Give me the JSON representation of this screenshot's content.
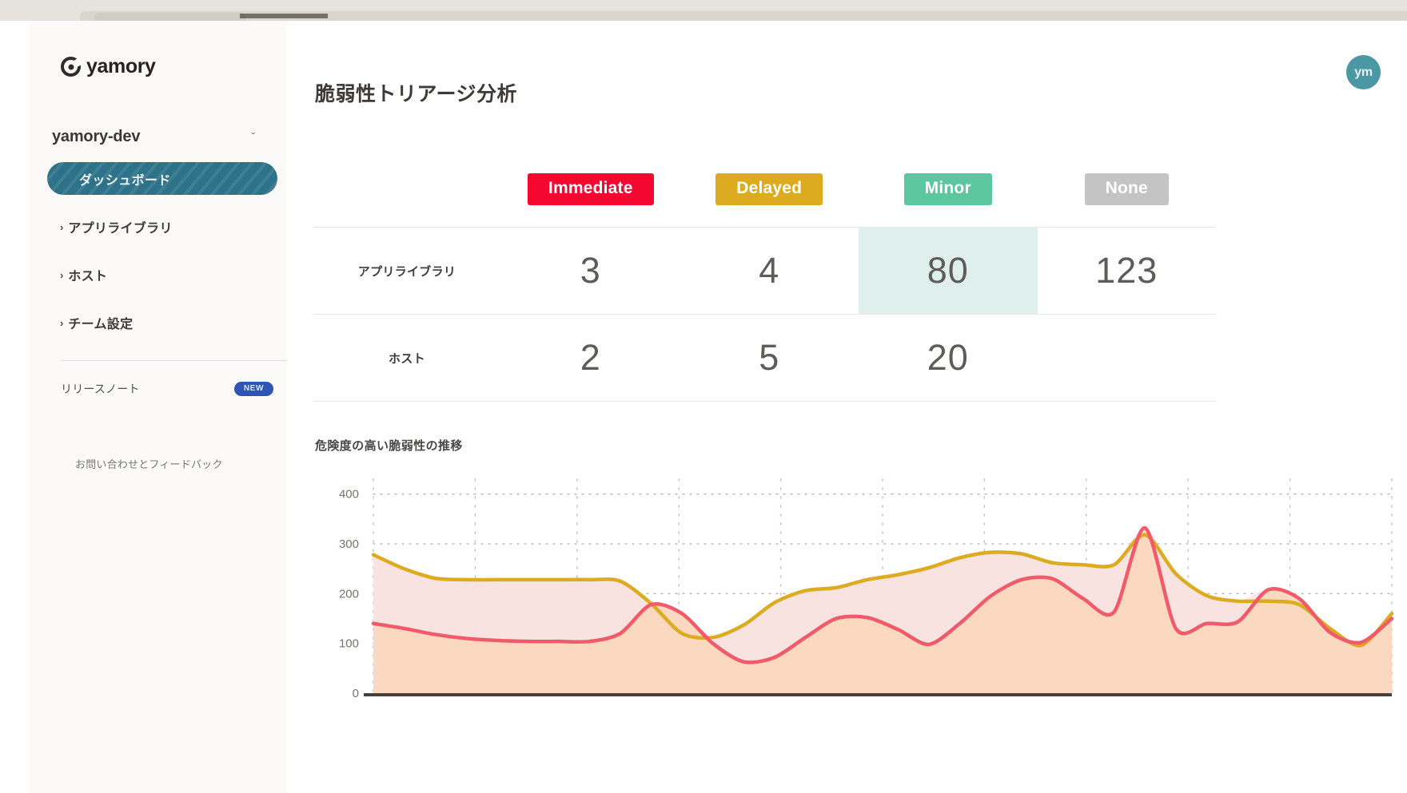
{
  "browser": {
    "tab_title": ""
  },
  "sidebar": {
    "brand": {
      "name": "yamory",
      "icon": "yamory-logo-icon"
    },
    "org": {
      "name": "yamory-dev",
      "caret": "ˇ"
    },
    "items": [
      {
        "label": "ダッシュボード",
        "active": true
      },
      {
        "label": "アプリライブラリ",
        "active": false,
        "chevron": "›"
      },
      {
        "label": "ホスト",
        "active": false,
        "chevron": "›"
      },
      {
        "label": "チーム設定",
        "active": false,
        "chevron": "›"
      }
    ],
    "release_notes": {
      "label": "リリースノート",
      "badge": "NEW"
    },
    "feedback": {
      "label": "お問い合わせとフィードバック"
    }
  },
  "header": {
    "title": "脆弱性トリアージ分析",
    "avatar_initials": "ym"
  },
  "triage_table": {
    "columns": [
      {
        "label": "Immediate",
        "color": "#f5082f"
      },
      {
        "label": "Delayed",
        "color": "#ddab20"
      },
      {
        "label": "Minor",
        "color": "#5cc6a0"
      },
      {
        "label": "None",
        "color": "#c4c4c4"
      }
    ],
    "rows": [
      {
        "label": "アプリライブラリ",
        "values": [
          "3",
          "4",
          "80",
          "123"
        ],
        "highlight_index": 2
      },
      {
        "label": "ホスト",
        "values": [
          "2",
          "5",
          "20",
          ""
        ],
        "highlight_index": -1
      }
    ],
    "highlight_color": "#dff0ec"
  },
  "chart_data": {
    "type": "area",
    "title": "危険度の高い脆弱性の推移",
    "xlabel": "",
    "ylabel": "",
    "ylim": [
      0,
      430
    ],
    "yticks": [
      0,
      100,
      200,
      300,
      400
    ],
    "ytick_labels": [
      "0",
      "100",
      "200",
      "300",
      "400"
    ],
    "grid": "dotted",
    "legend_position": "none",
    "x": [
      0,
      1,
      2,
      3,
      4,
      5,
      6,
      7,
      8,
      9,
      10,
      11,
      12,
      13,
      14,
      15,
      16,
      17,
      18,
      19,
      20,
      21,
      22,
      23,
      24,
      25,
      26,
      27,
      28,
      29,
      30,
      31,
      32,
      33
    ],
    "series": [
      {
        "name": "Delayed",
        "color": "#ddab20",
        "fill": "#f5f2cf",
        "values": [
          278,
          250,
          231,
          228,
          228,
          228,
          228,
          228,
          225,
          180,
          120,
          112,
          137,
          182,
          206,
          212,
          228,
          238,
          252,
          272,
          283,
          280,
          262,
          258,
          258,
          318,
          240,
          196,
          185,
          185,
          178,
          130,
          96,
          160
        ]
      },
      {
        "name": "Immediate",
        "color": "#f05a6a",
        "fill": "#fbd7be",
        "values": [
          140,
          130,
          118,
          110,
          106,
          104,
          104,
          104,
          120,
          178,
          160,
          100,
          63,
          72,
          112,
          150,
          152,
          128,
          98,
          140,
          195,
          228,
          230,
          190,
          163,
          332,
          130,
          140,
          143,
          208,
          190,
          122,
          102,
          150
        ]
      }
    ],
    "overlap_fill": "#fadde4"
  }
}
